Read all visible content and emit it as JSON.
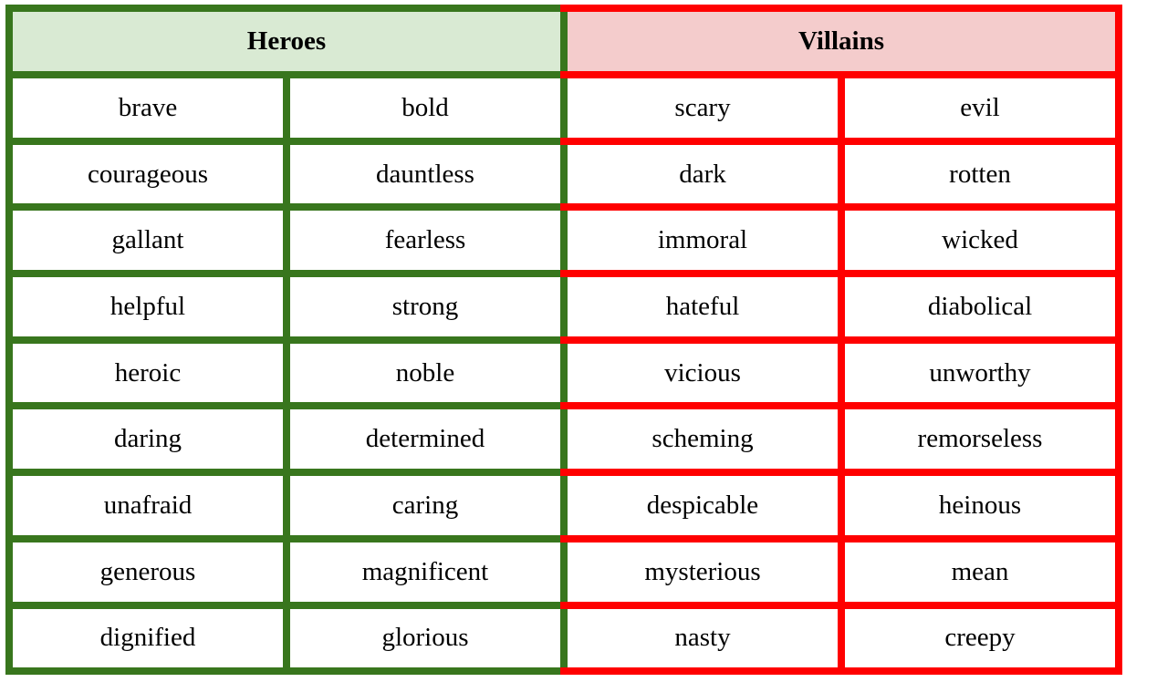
{
  "heroes": {
    "title": "Heroes",
    "border_color": "#38761d",
    "header_bg": "#d9ead3",
    "rows": [
      [
        "brave",
        "bold"
      ],
      [
        "courageous",
        "dauntless"
      ],
      [
        "gallant",
        "fearless"
      ],
      [
        "helpful",
        "strong"
      ],
      [
        "heroic",
        "noble"
      ],
      [
        "daring",
        "determined"
      ],
      [
        "unafraid",
        "caring"
      ],
      [
        "generous",
        "magnificent"
      ],
      [
        "dignified",
        "glorious"
      ]
    ]
  },
  "villains": {
    "title": "Villains",
    "border_color": "#ff0000",
    "header_bg": "#f4cccc",
    "rows": [
      [
        "scary",
        "evil"
      ],
      [
        "dark",
        "rotten"
      ],
      [
        "immoral",
        "wicked"
      ],
      [
        "hateful",
        "diabolical"
      ],
      [
        "vicious",
        "unworthy"
      ],
      [
        "scheming",
        "remorseless"
      ],
      [
        "despicable",
        "heinous"
      ],
      [
        "mysterious",
        "mean"
      ],
      [
        "nasty",
        "creepy"
      ]
    ]
  }
}
